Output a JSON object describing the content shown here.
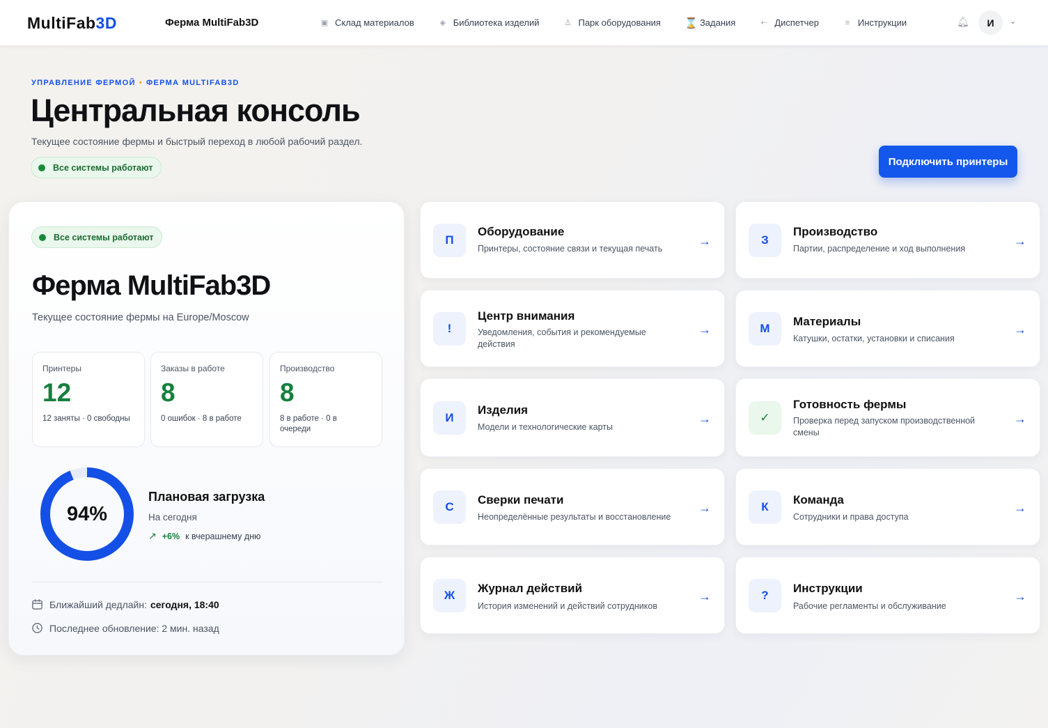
{
  "topbar": {
    "logo_main": "MultiFab",
    "logo_accent": "3D",
    "farm_name": "Ферма MultiFab3D",
    "nav": [
      {
        "label": "Склад материалов",
        "icon": "box-icon"
      },
      {
        "label": "Библиотека изделий",
        "icon": "cube-icon"
      },
      {
        "label": "Парк оборудования",
        "icon": "user-icon"
      },
      {
        "label": "Задания",
        "icon": "hourglass-icon"
      },
      {
        "label": "Диспетчер",
        "icon": "arrow-icon"
      },
      {
        "label": "Инструкции",
        "icon": "list-icon"
      }
    ],
    "avatar_letter": "И"
  },
  "header": {
    "breadcrumb_1": "УПРАВЛЕНИЕ ФЕРМОЙ",
    "breadcrumb_2": "ФЕРМА MULTIFAB3D",
    "title": "Центральная консоль",
    "subtitle": "Текущее состояние фермы и быстрый переход в любой рабочий раздел.",
    "status": "Все системы работают",
    "connect_button": "Подключить принтеры"
  },
  "summary": {
    "status": "Все системы работают",
    "title": "Ферма MultiFab3D",
    "subtitle": "Текущее состояние фермы на Europe/Moscow",
    "stats": [
      {
        "label": "Принтеры",
        "value": "12",
        "meta": "12 заняты · 0 свободны"
      },
      {
        "label": "Заказы в работе",
        "value": "8",
        "meta": "0 ошибок · 8 в работе"
      },
      {
        "label": "Производство",
        "value": "8",
        "meta": "8 в работе · 0 в очереди"
      }
    ],
    "load": {
      "percent_text": "94%",
      "percent": 94,
      "title": "Плановая загрузка",
      "subtitle": "На сегодня",
      "trend_value": "+6%",
      "trend_text": "к вчерашнему дню"
    },
    "deadline_label": "Ближайший дедлайн:",
    "deadline_value": "сегодня, 18:40",
    "updated": "Последнее обновление: 2 мин. назад"
  },
  "tiles": [
    {
      "badge": "П",
      "title": "Оборудование",
      "desc": "Принтеры, состояние связи и текущая печать"
    },
    {
      "badge": "З",
      "title": "Производство",
      "desc": "Партии, распределение и ход выполнения"
    },
    {
      "badge": "!",
      "title": "Центр внимания",
      "desc": "Уведомления, события и рекомендуемые действия"
    },
    {
      "badge": "М",
      "title": "Материалы",
      "desc": "Катушки, остатки, установки и списания"
    },
    {
      "badge": "И",
      "title": "Изделия",
      "desc": "Модели и технологические карты"
    },
    {
      "badge": "✓",
      "title": "Готовность фермы",
      "desc": "Проверка перед запуском производственной смены"
    },
    {
      "badge": "С",
      "title": "Сверки печати",
      "desc": "Неопределённые результаты и восстановление"
    },
    {
      "badge": "К",
      "title": "Команда",
      "desc": "Сотрудники и права доступа"
    },
    {
      "badge": "Ж",
      "title": "Журнал действий",
      "desc": "История изменений и действий сотрудников"
    },
    {
      "badge": "?",
      "title": "Инструкции",
      "desc": "Рабочие регламенты и обслуживание"
    }
  ],
  "colors": {
    "accent": "#1450e6",
    "success": "#15803d",
    "success_bg": "#e9f7ec",
    "ring_track": "#e6ebf5"
  }
}
